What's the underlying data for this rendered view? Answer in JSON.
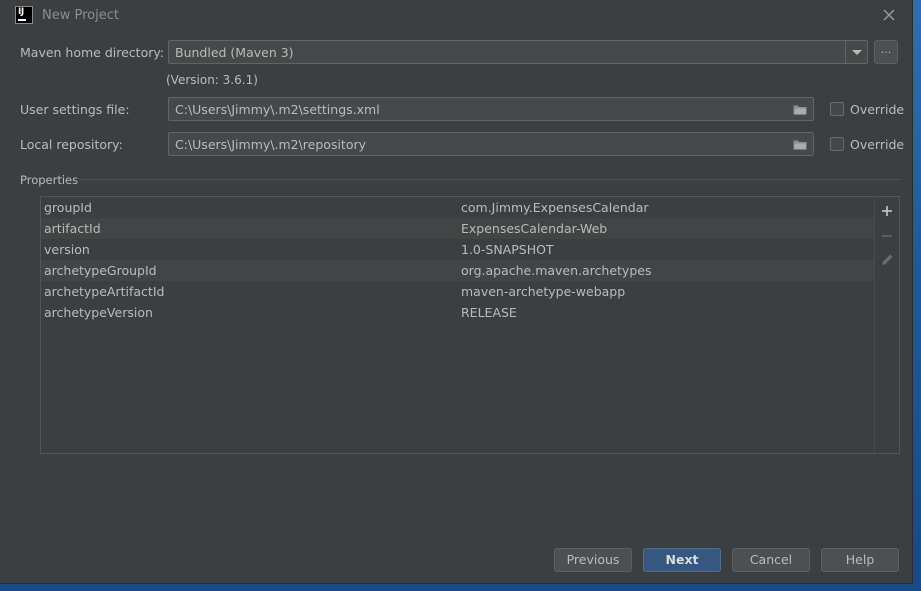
{
  "window": {
    "title": "New Project",
    "app_icon_text": "IJ"
  },
  "form": {
    "maven_home_label": "Maven home directory:",
    "maven_home_value": "Bundled (Maven 3)",
    "browse_label": "...",
    "version_text": "(Version: 3.6.1)",
    "user_settings_label": "User settings file:",
    "user_settings_value": "C:\\Users\\Jimmy\\.m2\\settings.xml",
    "local_repo_label": "Local repository:",
    "local_repo_value": "C:\\Users\\Jimmy\\.m2\\repository",
    "override_label": "Override",
    "override_user_settings_checked": false,
    "override_local_repo_checked": false
  },
  "properties": {
    "title": "Properties",
    "rows": [
      {
        "key": "groupId",
        "value": "com.Jimmy.ExpensesCalendar"
      },
      {
        "key": "artifactId",
        "value": "ExpensesCalendar-Web"
      },
      {
        "key": "version",
        "value": "1.0-SNAPSHOT"
      },
      {
        "key": "archetypeGroupId",
        "value": "org.apache.maven.archetypes"
      },
      {
        "key": "archetypeArtifactId",
        "value": "maven-archetype-webapp"
      },
      {
        "key": "archetypeVersion",
        "value": "RELEASE"
      }
    ]
  },
  "footer": {
    "previous_label": "Previous",
    "next_label": "Next",
    "cancel_label": "Cancel",
    "help_label": "Help"
  },
  "colors": {
    "dialog_bg": "#3c3f41",
    "field_bg": "#45494a",
    "primary_button": "#365880",
    "text": "#bbbbbb"
  }
}
